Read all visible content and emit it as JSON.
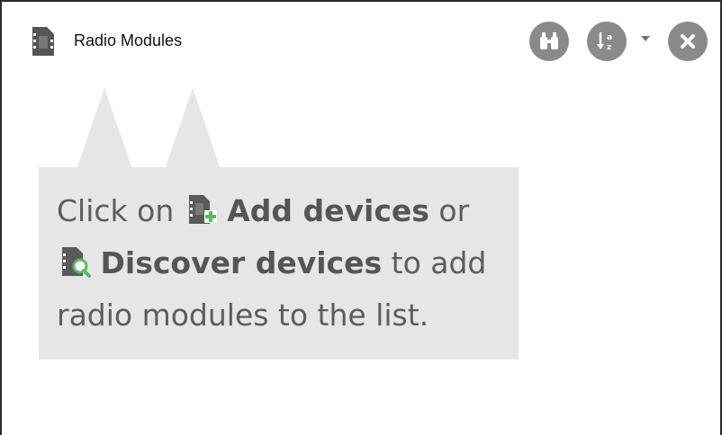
{
  "header": {
    "title": "Radio Modules",
    "title_icon": "radio-module-icon",
    "buttons": [
      {
        "name": "find-devices",
        "icon": "binoculars-icon"
      },
      {
        "name": "sort",
        "icon": "sort-az-icon"
      },
      {
        "name": "sort-options",
        "icon": "caret-down-icon"
      },
      {
        "name": "close",
        "icon": "close-icon"
      }
    ]
  },
  "tip": {
    "part1": "Click on ",
    "add_label": "Add devices",
    "part2": " or ",
    "discover_label": "Discover devices",
    "part3": " to add radio modules to the list.",
    "add_icon": "add-device-icon",
    "discover_icon": "discover-device-icon"
  },
  "colors": {
    "button_gray": "#8a8a8a",
    "tip_background": "#e6e6e6",
    "tip_text": "#5c5c5c",
    "add_green": "#5cb85c"
  }
}
